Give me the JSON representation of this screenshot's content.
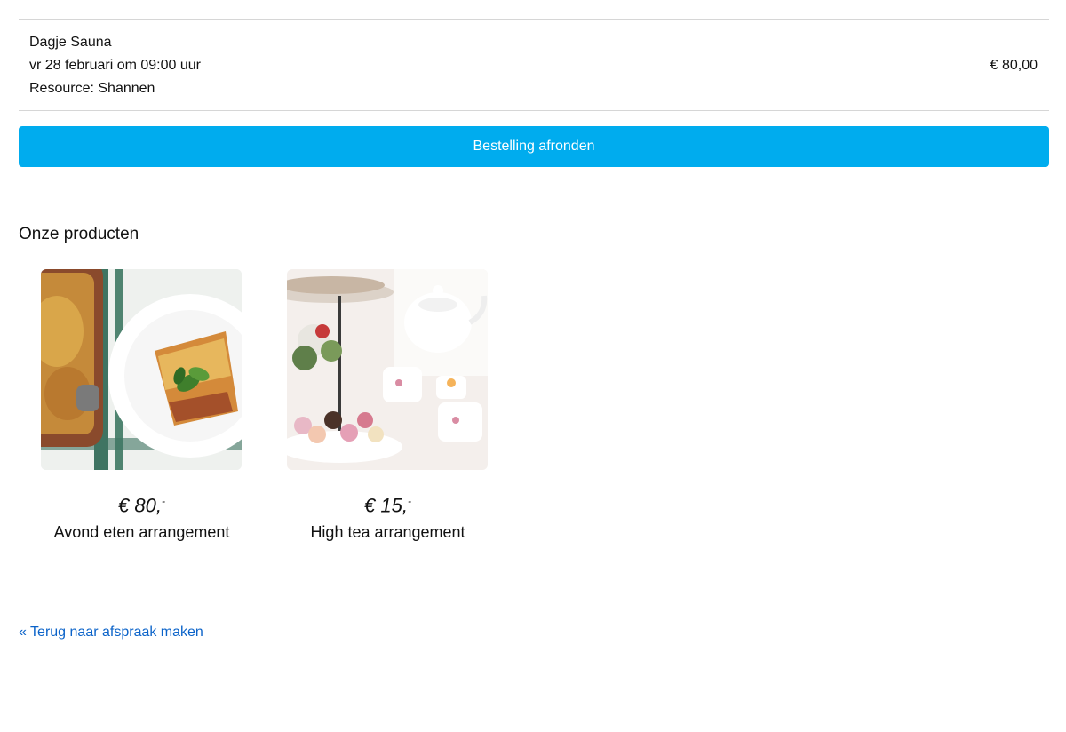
{
  "order": {
    "item_title": "Dagje Sauna",
    "item_datetime": "vr 28 februari om 09:00 uur",
    "item_resource": "Resource: Shannen",
    "item_price": "€ 80,00"
  },
  "checkout": {
    "button_label": "Bestelling afronden"
  },
  "products": {
    "title": "Onze producten",
    "items": [
      {
        "price_main": "€ 80,",
        "price_sup": "-",
        "name": "Avond eten arrangement",
        "image": "lasagna-photo"
      },
      {
        "price_main": "€ 15,",
        "price_sup": "-",
        "name": "High tea arrangement",
        "image": "high-tea-photo"
      }
    ]
  },
  "back_link": {
    "label": "« Terug naar afspraak maken"
  },
  "colors": {
    "accent": "#00acee",
    "link": "#0b63c9",
    "divider": "#d6d6d6"
  }
}
